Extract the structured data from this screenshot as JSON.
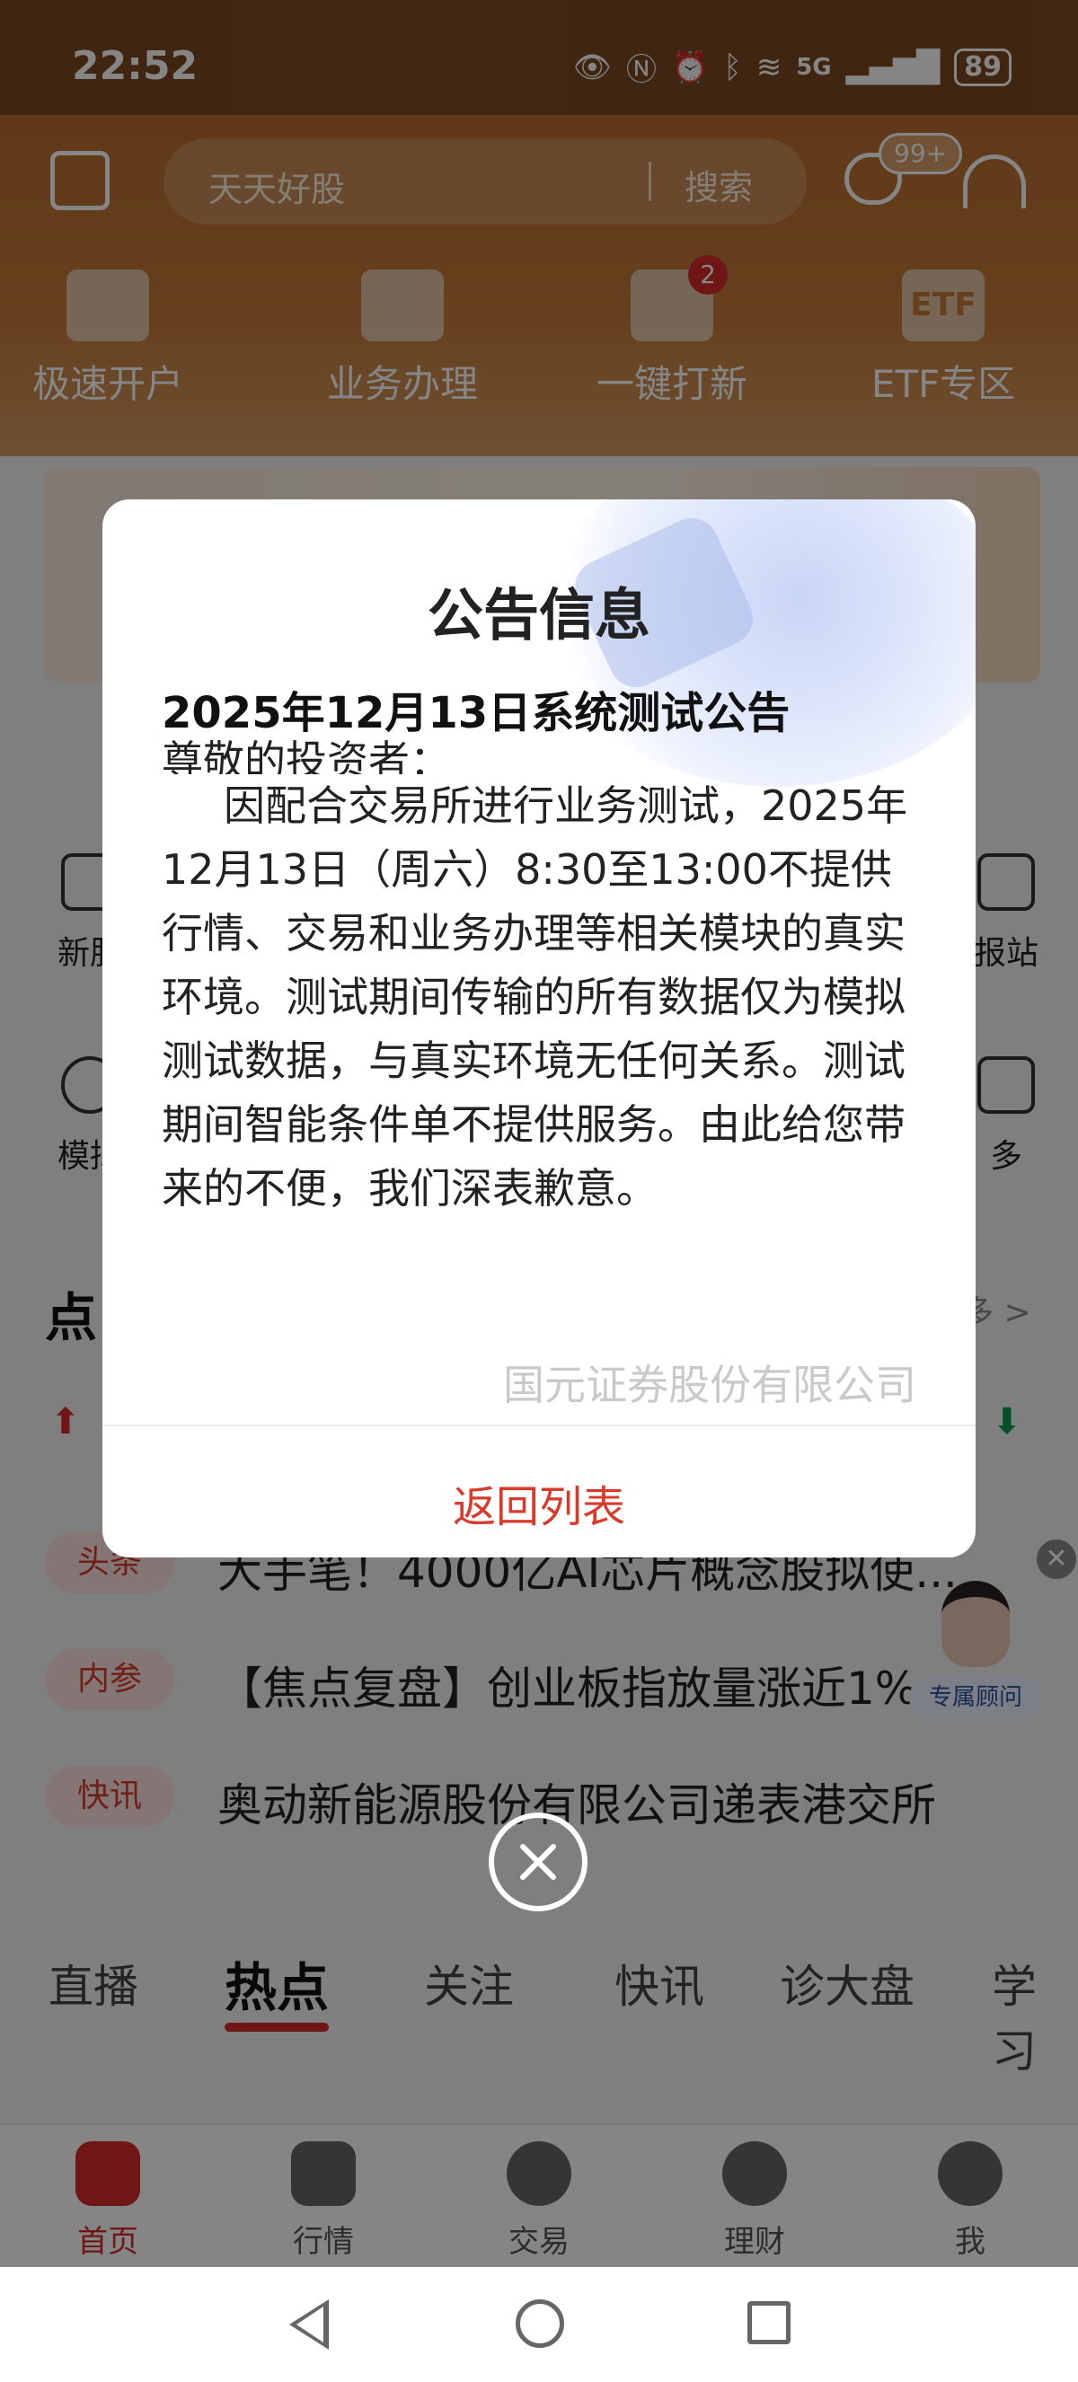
{
  "status_bar": {
    "time": "22:52",
    "network": "5G",
    "battery": "89"
  },
  "header": {
    "search_placeholder": "天天好股",
    "search_button": "搜索",
    "message_badge": "99+"
  },
  "quick_actions": [
    {
      "label": "极速开户",
      "icon": "account-open-icon"
    },
    {
      "label": "业务办理",
      "icon": "briefcase-icon"
    },
    {
      "label": "一键打新",
      "icon": "rocket-icon",
      "badge": "2"
    },
    {
      "label": "ETF专区",
      "icon": "etf-icon",
      "icon_text": "ETF"
    }
  ],
  "grid_partial": {
    "left_row1": "新股",
    "right_row1": "报站",
    "left_row2": "模拟",
    "right_row2": "多"
  },
  "hot": {
    "title": "点",
    "more": "多 >",
    "news": [
      {
        "tag": "头条",
        "text": "大手笔！4000亿AI芯片概念股拟使..."
      },
      {
        "tag": "内参",
        "text": "【焦点复盘】创业板指放量涨近1%"
      },
      {
        "tag": "快讯",
        "text": "奥动新能源股份有限公司递表港交所"
      }
    ]
  },
  "advisor": {
    "label": "专属顾问"
  },
  "content_tabs": [
    "直播",
    "热点",
    "关注",
    "快讯",
    "诊大盘",
    "学习"
  ],
  "active_tab": "热点",
  "bottom_nav": [
    {
      "label": "首页",
      "active": true
    },
    {
      "label": "行情",
      "active": false
    },
    {
      "label": "交易",
      "active": false
    },
    {
      "label": "理财",
      "active": false
    },
    {
      "label": "我",
      "active": false
    }
  ],
  "modal": {
    "title": "公告信息",
    "subtitle": "2025年12月13日系统测试公告",
    "greeting": "尊敬的投资者：",
    "body": "因配合交易所进行业务测试，2025年12月13日（周六）8:30至13:00不提供行情、交易和业务办理等相关模块的真实环境。测试期间传输的所有数据仅为模拟测试数据，与真实环境无任何关系。测试期间智能条件单不提供服务。由此给您带来的不便，我们深表歉意。",
    "signature": "国元证券股份有限公司",
    "return_button": "返回列表"
  },
  "colors": {
    "brand": "#c47c3a",
    "accent_red": "#d83b2b"
  }
}
